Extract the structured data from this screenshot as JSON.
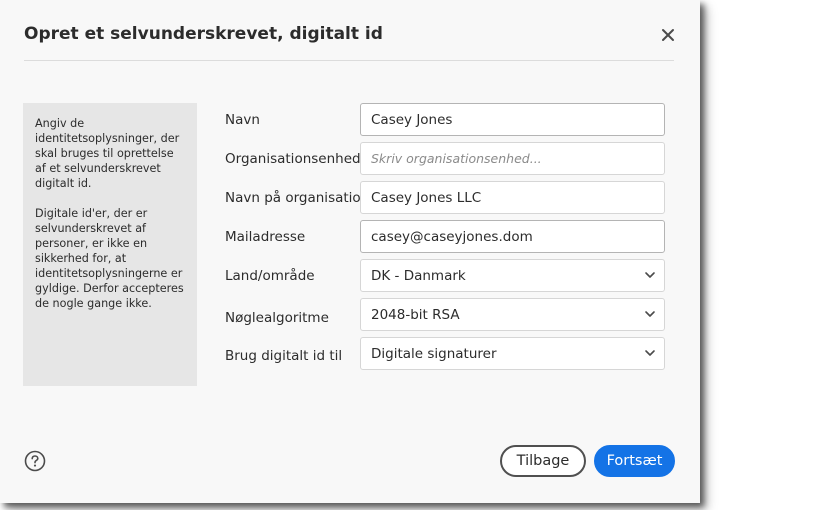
{
  "dialog": {
    "title": "Opret et selvunderskrevet, digitalt id"
  },
  "icons": {
    "close": "close-icon",
    "help": "help-icon",
    "dropdown": "chevron-down-icon"
  },
  "info": {
    "paragraph1": "Angiv de identitetsoplysninger, der skal bruges til oprettelse af et selvunderskrevet digitalt id.",
    "paragraph2": "Digitale id'er, der er selvunderskrevet af personer, er ikke en sikkerhed for, at identitetsoplysningerne er gyldige. Derfor accepteres de nogle gange ikke."
  },
  "form": {
    "name": {
      "label": "Navn",
      "value": "Casey Jones"
    },
    "org_unit": {
      "label": "Organisationsenhed",
      "value": "",
      "placeholder": "Skriv organisationsenhed..."
    },
    "org_name": {
      "label": "Navn på organisation",
      "value": "Casey Jones LLC"
    },
    "email": {
      "label": "Mailadresse",
      "value": "casey@caseyjones.dom"
    },
    "country": {
      "label": "Land/område",
      "value": "DK - Danmark"
    },
    "key_algorithm": {
      "label": "Nøglealgoritme",
      "value": "2048-bit RSA"
    },
    "use_for": {
      "label": "Brug digitalt id til",
      "value": "Digitale signaturer"
    }
  },
  "buttons": {
    "back": "Tilbage",
    "continue": "Fortsæt"
  },
  "colors": {
    "accent": "#1473e6",
    "dialog_bg": "#f8f8f8",
    "panel_bg": "#e6e6e6"
  }
}
